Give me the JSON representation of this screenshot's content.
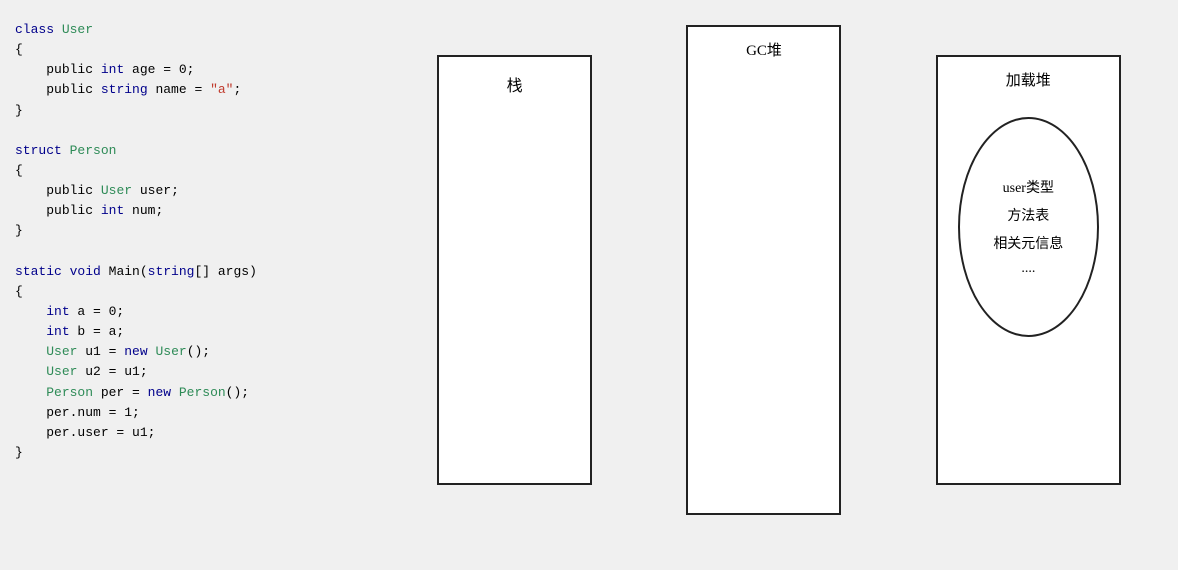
{
  "code": {
    "lines": [
      {
        "text": "class User",
        "type": "mixed"
      },
      {
        "text": "{",
        "type": "plain"
      },
      {
        "text": "    public int age = 0;",
        "type": "mixed"
      },
      {
        "text": "    public string name = \"a\";",
        "type": "mixed"
      },
      {
        "text": "}",
        "type": "plain"
      },
      {
        "text": "",
        "type": "plain"
      },
      {
        "text": "struct Person",
        "type": "mixed"
      },
      {
        "text": "{",
        "type": "plain"
      },
      {
        "text": "    public User user;",
        "type": "mixed"
      },
      {
        "text": "    public int num;",
        "type": "mixed"
      },
      {
        "text": "}",
        "type": "plain"
      },
      {
        "text": "",
        "type": "plain"
      },
      {
        "text": "static void Main(string[] args)",
        "type": "mixed"
      },
      {
        "text": "{",
        "type": "plain"
      },
      {
        "text": "    int a = 0;",
        "type": "mixed"
      },
      {
        "text": "    int b = a;",
        "type": "mixed"
      },
      {
        "text": "    User u1 = new User();",
        "type": "mixed"
      },
      {
        "text": "    User u2 = u1;",
        "type": "mixed"
      },
      {
        "text": "    Person per = new Person();",
        "type": "mixed"
      },
      {
        "text": "    per.num = 1;",
        "type": "plain"
      },
      {
        "text": "    per.user = u1;",
        "type": "plain"
      },
      {
        "text": "}",
        "type": "plain"
      }
    ]
  },
  "stack": {
    "label": "栈"
  },
  "gc_heap": {
    "label": "GC堆"
  },
  "load_heap": {
    "label": "加载堆",
    "oval": {
      "line1": "user类型",
      "line2": "方法表",
      "line3": "相关元信息",
      "line4": "...."
    }
  }
}
